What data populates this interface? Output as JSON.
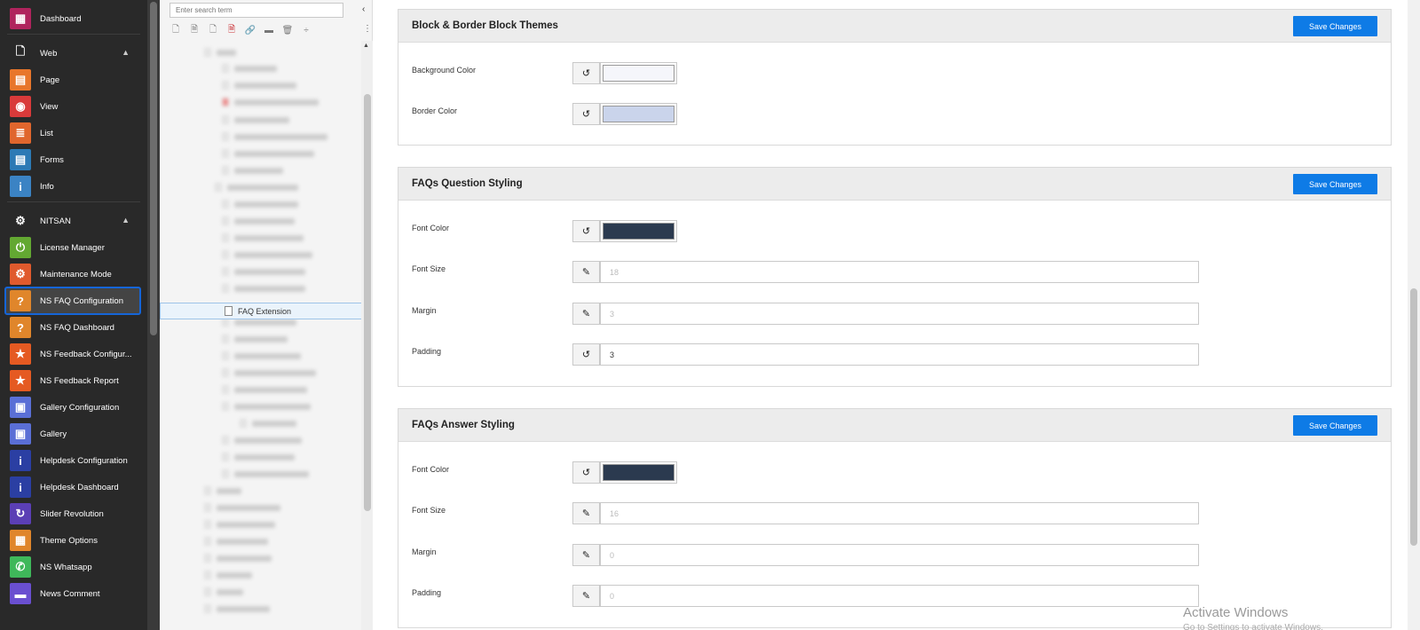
{
  "sidebar": {
    "items": [
      {
        "label": "Dashboard",
        "icon": "dashboard-icon",
        "color": "#b0245d",
        "glyph": "▦"
      },
      {
        "label": "Page",
        "icon": "page-icon",
        "color": "#e8762b",
        "glyph": "▤"
      },
      {
        "label": "View",
        "icon": "eye-icon",
        "color": "#d93a3a",
        "glyph": "◉"
      },
      {
        "label": "List",
        "icon": "list-icon",
        "color": "#e0662d",
        "glyph": "≣"
      },
      {
        "label": "Forms",
        "icon": "forms-icon",
        "color": "#2c7ab5",
        "glyph": "▤"
      },
      {
        "label": "Info",
        "icon": "info-icon",
        "color": "#3b83c4",
        "glyph": "i"
      },
      {
        "label": "License Manager",
        "icon": "power-icon",
        "color": "#63a832",
        "glyph": "⏻"
      },
      {
        "label": "Maintenance Mode",
        "icon": "maintenance-icon",
        "color": "#e05a2d",
        "glyph": "⚙"
      },
      {
        "label": "NS FAQ Configuration",
        "icon": "faq-icon",
        "color": "#e0862b",
        "glyph": "?"
      },
      {
        "label": "NS FAQ Dashboard",
        "icon": "faq-icon",
        "color": "#e0862b",
        "glyph": "?"
      },
      {
        "label": "NS Feedback Configur...",
        "icon": "star-icon",
        "color": "#e55a22",
        "glyph": "★"
      },
      {
        "label": "NS Feedback Report",
        "icon": "star-icon",
        "color": "#e55a22",
        "glyph": "★"
      },
      {
        "label": "Gallery Configuration",
        "icon": "gallery-icon",
        "color": "#5a6fd6",
        "glyph": "▣"
      },
      {
        "label": "Gallery",
        "icon": "gallery-icon",
        "color": "#5a6fd6",
        "glyph": "▣"
      },
      {
        "label": "Helpdesk Configuration",
        "icon": "helpdesk-icon",
        "color": "#2b3fa3",
        "glyph": "i"
      },
      {
        "label": "Helpdesk Dashboard",
        "icon": "helpdesk-icon",
        "color": "#2b3fa3",
        "glyph": "i"
      },
      {
        "label": "Slider Revolution",
        "icon": "refresh-icon",
        "color": "#5b3fb5",
        "glyph": "↻"
      },
      {
        "label": "Theme Options",
        "icon": "theme-icon",
        "color": "#e0862b",
        "glyph": "▦"
      },
      {
        "label": "NS Whatsapp",
        "icon": "whatsapp-icon",
        "color": "#3fb85a",
        "glyph": "✆"
      },
      {
        "label": "News Comment",
        "icon": "comment-icon",
        "color": "#6a4fd0",
        "glyph": "▬"
      }
    ],
    "groups": {
      "web": "Web",
      "nitsan": "NITSAN"
    }
  },
  "tree": {
    "search_placeholder": "Enter search term",
    "selected_label": "FAQ Extension"
  },
  "panels": [
    {
      "title": "Block & Border Block Themes",
      "save_label": "Save Changes",
      "fields": [
        {
          "label": "Background Color",
          "type": "color",
          "value": "#f5f6fb"
        },
        {
          "label": "Border Color",
          "type": "color",
          "value": "#cad4eb"
        }
      ]
    },
    {
      "title": "FAQs Question Styling",
      "save_label": "Save Changes",
      "fields": [
        {
          "label": "Font Color",
          "type": "color",
          "value": "#2b3a4f"
        },
        {
          "label": "Font Size",
          "type": "text",
          "value": "18"
        },
        {
          "label": "Margin",
          "type": "text",
          "value": "3"
        },
        {
          "label": "Padding",
          "type": "text",
          "value": "3"
        }
      ]
    },
    {
      "title": "FAQs Answer Styling",
      "save_label": "Save Changes",
      "fields": [
        {
          "label": "Font Color",
          "type": "color",
          "value": "#2b3a4f"
        },
        {
          "label": "Font Size",
          "type": "text",
          "value": "16"
        },
        {
          "label": "Margin",
          "type": "text",
          "value": "0"
        },
        {
          "label": "Padding",
          "type": "text",
          "value": "0"
        }
      ]
    }
  ],
  "watermark": {
    "title": "Activate Windows",
    "subtitle": "Go to Settings to activate Windows."
  },
  "colors": {
    "accent": "#0e7be6",
    "sidebar_bg": "#292929",
    "active_outline": "#1565d8"
  }
}
